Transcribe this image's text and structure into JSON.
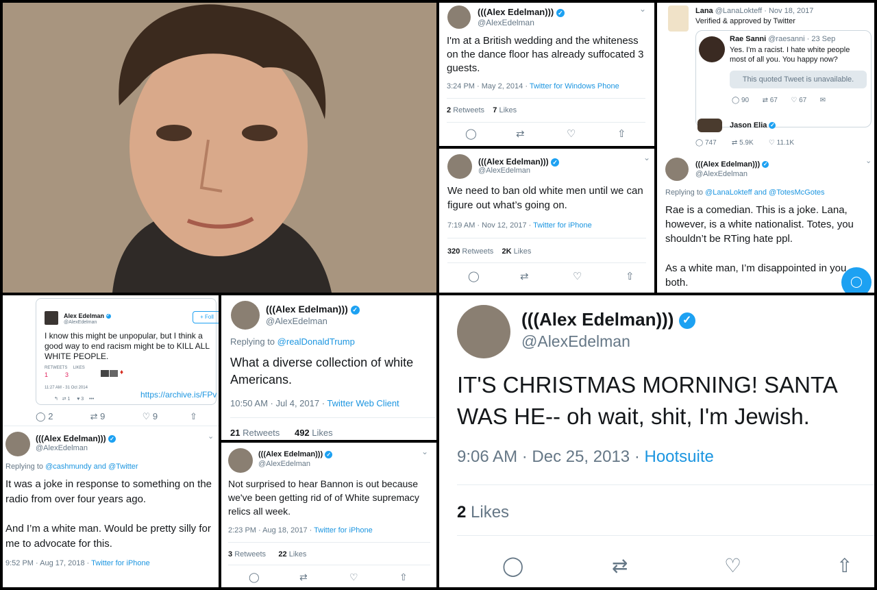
{
  "handle": "@AlexEdelman",
  "display_name": "(((Alex Edelman)))",
  "verified_icon": "verified-badge-icon",
  "tweets": [
    {
      "text": "I'm at a British wedding and the whiteness on the dance floor has already suffocated 3 guests.",
      "time": "3:24 PM · May 2, 2014",
      "client": "Twitter for Windows Phone",
      "retweets": "2",
      "retweets_label": "Retweets",
      "likes": "7",
      "likes_label": "Likes"
    },
    {
      "text": "We need to ban old white men until we can figure out what’s going on.",
      "time": "7:19 AM · Nov 12, 2017",
      "client": "Twitter for iPhone",
      "retweets": "320",
      "retweets_label": "Retweets",
      "likes": "2K",
      "likes_label": "Likes"
    },
    {
      "reply_prefix": "Replying to",
      "reply_to": "@realDonaldTrump",
      "text": "What a diverse collection of white Americans.",
      "time": "10:50 AM · Jul 4, 2017",
      "client": "Twitter Web Client",
      "retweets": "21",
      "retweets_label": "Retweets",
      "likes": "492",
      "likes_label": "Likes"
    },
    {
      "text": "Not surprised to hear Bannon is out because we've been getting rid of of White supremacy relics all week.",
      "time": "2:23 PM · Aug 18, 2017",
      "client": "Twitter for iPhone",
      "retweets": "3",
      "retweets_label": "Retweets",
      "likes": "22",
      "likes_label": "Likes"
    },
    {
      "text": "IT'S CHRISTMAS MORNING! SANTA WAS HE-- oh wait, shit, I'm Jewish.",
      "time": "9:06 AM · Dec 25, 2013",
      "client": "Hootsuite",
      "likes": "2",
      "likes_label": "Likes"
    }
  ],
  "thread": {
    "lana_name": "Lana",
    "lana_handle": "@LanaLokteff · Nov 18, 2017",
    "lana_bio": "Verified & approved by Twitter",
    "rae_name": "Rae Sanni",
    "rae_handle": "@raesanni · 23 Sep",
    "rae_text": "Yes. I'm a racist. I hate white people most of all you. You happy now?",
    "quoted_unavailable": "This quoted Tweet is unavailable.",
    "rae_replies": "90",
    "rae_retweets": "67",
    "rae_likes": "67",
    "jason_name": "Jason Elia",
    "lana_replies": "747",
    "lana_retweets": "5.9K",
    "lana_likes": "11.1K",
    "reply_prefix": "Replying to",
    "reply_to": "@LanaLokteff and @TotesMcGotes",
    "reply_text_1": "Rae is a comedian. This is a joke. Lana, however, is a white nationalist. Totes, you shouldn’t be RTing hate ppl.",
    "reply_text_2": "As a white man, I’m disappointed in you both."
  },
  "archive": {
    "name": "Alex Edelman",
    "handle": "@AlexEdelman",
    "follow": "Foll",
    "text": "I know this might be unpopular, but I think a good way to end racism might be to KILL ALL WHITE PEOPLE.",
    "retweets_label": "RETWEETS",
    "retweets": "1",
    "likes_label": "LIKES",
    "likes": "3",
    "time": "11:27 AM - 31 Oct 2014",
    "rt_count": "1",
    "like_count": "3",
    "link": "https://archive.is/FPv",
    "replies": "2",
    "retweets_count": "9",
    "likes_count": "9",
    "reply_prefix": "Replying to",
    "reply_to": "@cashmundy and @Twitter",
    "reply_text_1": "It was a joke in response to something on the radio from over four years ago.",
    "reply_text_2": "And I’m a white man. Would be pretty silly for me to advocate for this.",
    "time2": "9:52 PM · Aug 17, 2018",
    "client2": "Twitter for iPhone"
  },
  "colors": {
    "link": "#1b95e0",
    "muted": "#657786",
    "verified": "#1da1f2",
    "border": "#e6ecf0"
  }
}
